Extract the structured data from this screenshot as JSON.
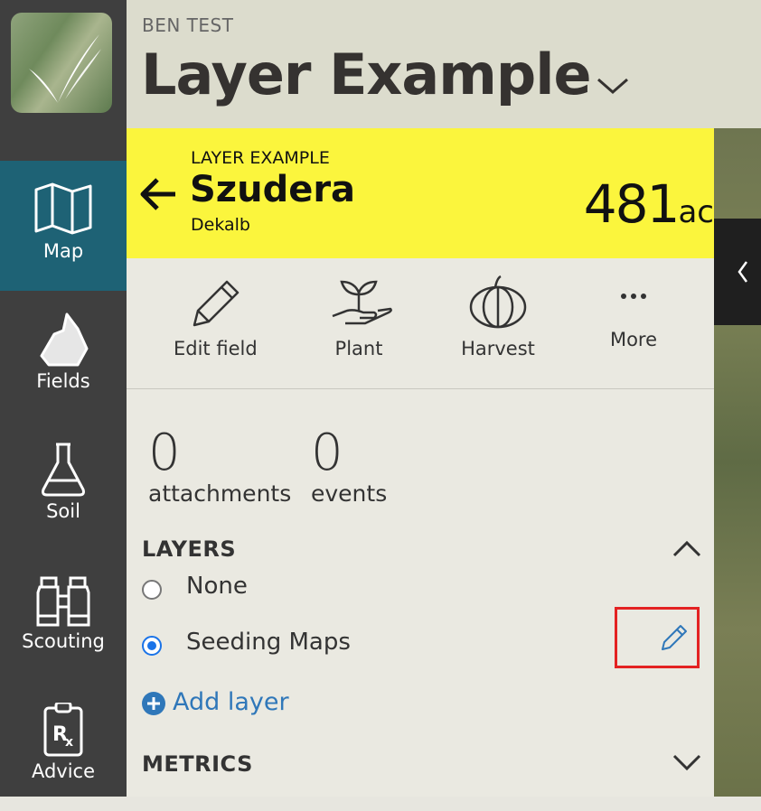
{
  "header": {
    "org_name": "BEN TEST",
    "page_title": "Layer Example"
  },
  "nav": {
    "items": [
      {
        "label": "Map",
        "icon": "map-icon"
      },
      {
        "label": "Fields",
        "icon": "fields-icon"
      },
      {
        "label": "Soil",
        "icon": "flask-icon"
      },
      {
        "label": "Scouting",
        "icon": "binoculars-icon"
      },
      {
        "label": "Advice",
        "icon": "prescription-clipboard-icon"
      }
    ]
  },
  "field": {
    "farm": "LAYER EXAMPLE",
    "name": "Szudera",
    "crop": "Dekalb",
    "acres": "481",
    "acres_unit": "ac"
  },
  "actions": [
    {
      "label": "Edit field",
      "icon": "pencil-icon"
    },
    {
      "label": "Plant",
      "icon": "seedling-hand-icon"
    },
    {
      "label": "Harvest",
      "icon": "pumpkin-icon"
    },
    {
      "label": "More",
      "icon": "more-dots-icon"
    }
  ],
  "counts": {
    "attachments_value": "0",
    "attachments_label": "attachments",
    "events_value": "0",
    "events_label": "events"
  },
  "layers": {
    "heading": "LAYERS",
    "options": [
      {
        "label": "None",
        "selected": false
      },
      {
        "label": "Seeding Maps",
        "selected": true
      }
    ],
    "add_label": "Add layer"
  },
  "metrics": {
    "heading": "METRICS"
  },
  "colors": {
    "banner": "#fbf53d",
    "active_nav": "#1e6275",
    "link": "#2f77b9",
    "highlight": "#e32222"
  }
}
